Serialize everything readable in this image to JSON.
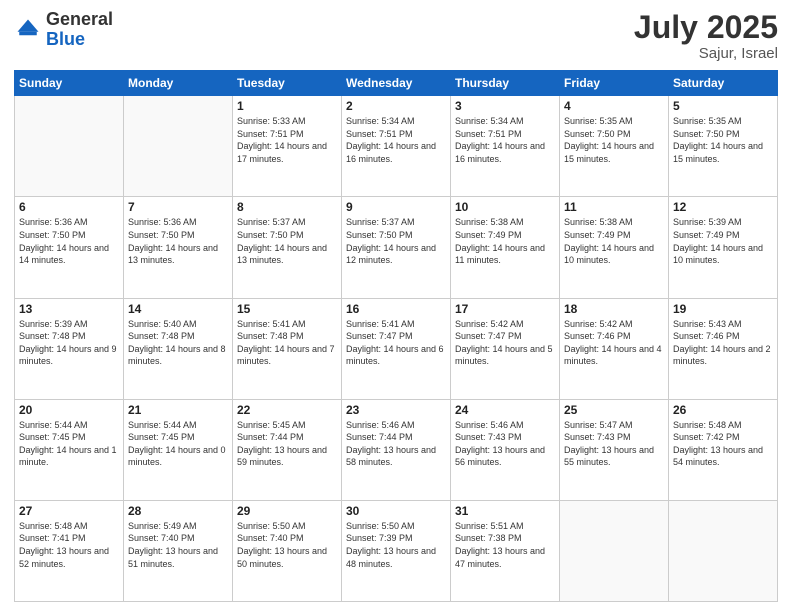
{
  "header": {
    "logo_general": "General",
    "logo_blue": "Blue",
    "month": "July 2025",
    "location": "Sajur, Israel"
  },
  "weekdays": [
    "Sunday",
    "Monday",
    "Tuesday",
    "Wednesday",
    "Thursday",
    "Friday",
    "Saturday"
  ],
  "weeks": [
    [
      {
        "day": "",
        "empty": true
      },
      {
        "day": "",
        "empty": true
      },
      {
        "day": "1",
        "sunrise": "5:33 AM",
        "sunset": "7:51 PM",
        "daylight": "14 hours and 17 minutes."
      },
      {
        "day": "2",
        "sunrise": "5:34 AM",
        "sunset": "7:51 PM",
        "daylight": "14 hours and 16 minutes."
      },
      {
        "day": "3",
        "sunrise": "5:34 AM",
        "sunset": "7:51 PM",
        "daylight": "14 hours and 16 minutes."
      },
      {
        "day": "4",
        "sunrise": "5:35 AM",
        "sunset": "7:50 PM",
        "daylight": "14 hours and 15 minutes."
      },
      {
        "day": "5",
        "sunrise": "5:35 AM",
        "sunset": "7:50 PM",
        "daylight": "14 hours and 15 minutes."
      }
    ],
    [
      {
        "day": "6",
        "sunrise": "5:36 AM",
        "sunset": "7:50 PM",
        "daylight": "14 hours and 14 minutes."
      },
      {
        "day": "7",
        "sunrise": "5:36 AM",
        "sunset": "7:50 PM",
        "daylight": "14 hours and 13 minutes."
      },
      {
        "day": "8",
        "sunrise": "5:37 AM",
        "sunset": "7:50 PM",
        "daylight": "14 hours and 13 minutes."
      },
      {
        "day": "9",
        "sunrise": "5:37 AM",
        "sunset": "7:50 PM",
        "daylight": "14 hours and 12 minutes."
      },
      {
        "day": "10",
        "sunrise": "5:38 AM",
        "sunset": "7:49 PM",
        "daylight": "14 hours and 11 minutes."
      },
      {
        "day": "11",
        "sunrise": "5:38 AM",
        "sunset": "7:49 PM",
        "daylight": "14 hours and 10 minutes."
      },
      {
        "day": "12",
        "sunrise": "5:39 AM",
        "sunset": "7:49 PM",
        "daylight": "14 hours and 10 minutes."
      }
    ],
    [
      {
        "day": "13",
        "sunrise": "5:39 AM",
        "sunset": "7:48 PM",
        "daylight": "14 hours and 9 minutes."
      },
      {
        "day": "14",
        "sunrise": "5:40 AM",
        "sunset": "7:48 PM",
        "daylight": "14 hours and 8 minutes."
      },
      {
        "day": "15",
        "sunrise": "5:41 AM",
        "sunset": "7:48 PM",
        "daylight": "14 hours and 7 minutes."
      },
      {
        "day": "16",
        "sunrise": "5:41 AM",
        "sunset": "7:47 PM",
        "daylight": "14 hours and 6 minutes."
      },
      {
        "day": "17",
        "sunrise": "5:42 AM",
        "sunset": "7:47 PM",
        "daylight": "14 hours and 5 minutes."
      },
      {
        "day": "18",
        "sunrise": "5:42 AM",
        "sunset": "7:46 PM",
        "daylight": "14 hours and 4 minutes."
      },
      {
        "day": "19",
        "sunrise": "5:43 AM",
        "sunset": "7:46 PM",
        "daylight": "14 hours and 2 minutes."
      }
    ],
    [
      {
        "day": "20",
        "sunrise": "5:44 AM",
        "sunset": "7:45 PM",
        "daylight": "14 hours and 1 minute."
      },
      {
        "day": "21",
        "sunrise": "5:44 AM",
        "sunset": "7:45 PM",
        "daylight": "14 hours and 0 minutes."
      },
      {
        "day": "22",
        "sunrise": "5:45 AM",
        "sunset": "7:44 PM",
        "daylight": "13 hours and 59 minutes."
      },
      {
        "day": "23",
        "sunrise": "5:46 AM",
        "sunset": "7:44 PM",
        "daylight": "13 hours and 58 minutes."
      },
      {
        "day": "24",
        "sunrise": "5:46 AM",
        "sunset": "7:43 PM",
        "daylight": "13 hours and 56 minutes."
      },
      {
        "day": "25",
        "sunrise": "5:47 AM",
        "sunset": "7:43 PM",
        "daylight": "13 hours and 55 minutes."
      },
      {
        "day": "26",
        "sunrise": "5:48 AM",
        "sunset": "7:42 PM",
        "daylight": "13 hours and 54 minutes."
      }
    ],
    [
      {
        "day": "27",
        "sunrise": "5:48 AM",
        "sunset": "7:41 PM",
        "daylight": "13 hours and 52 minutes."
      },
      {
        "day": "28",
        "sunrise": "5:49 AM",
        "sunset": "7:40 PM",
        "daylight": "13 hours and 51 minutes."
      },
      {
        "day": "29",
        "sunrise": "5:50 AM",
        "sunset": "7:40 PM",
        "daylight": "13 hours and 50 minutes."
      },
      {
        "day": "30",
        "sunrise": "5:50 AM",
        "sunset": "7:39 PM",
        "daylight": "13 hours and 48 minutes."
      },
      {
        "day": "31",
        "sunrise": "5:51 AM",
        "sunset": "7:38 PM",
        "daylight": "13 hours and 47 minutes."
      },
      {
        "day": "",
        "empty": true
      },
      {
        "day": "",
        "empty": true
      }
    ]
  ]
}
